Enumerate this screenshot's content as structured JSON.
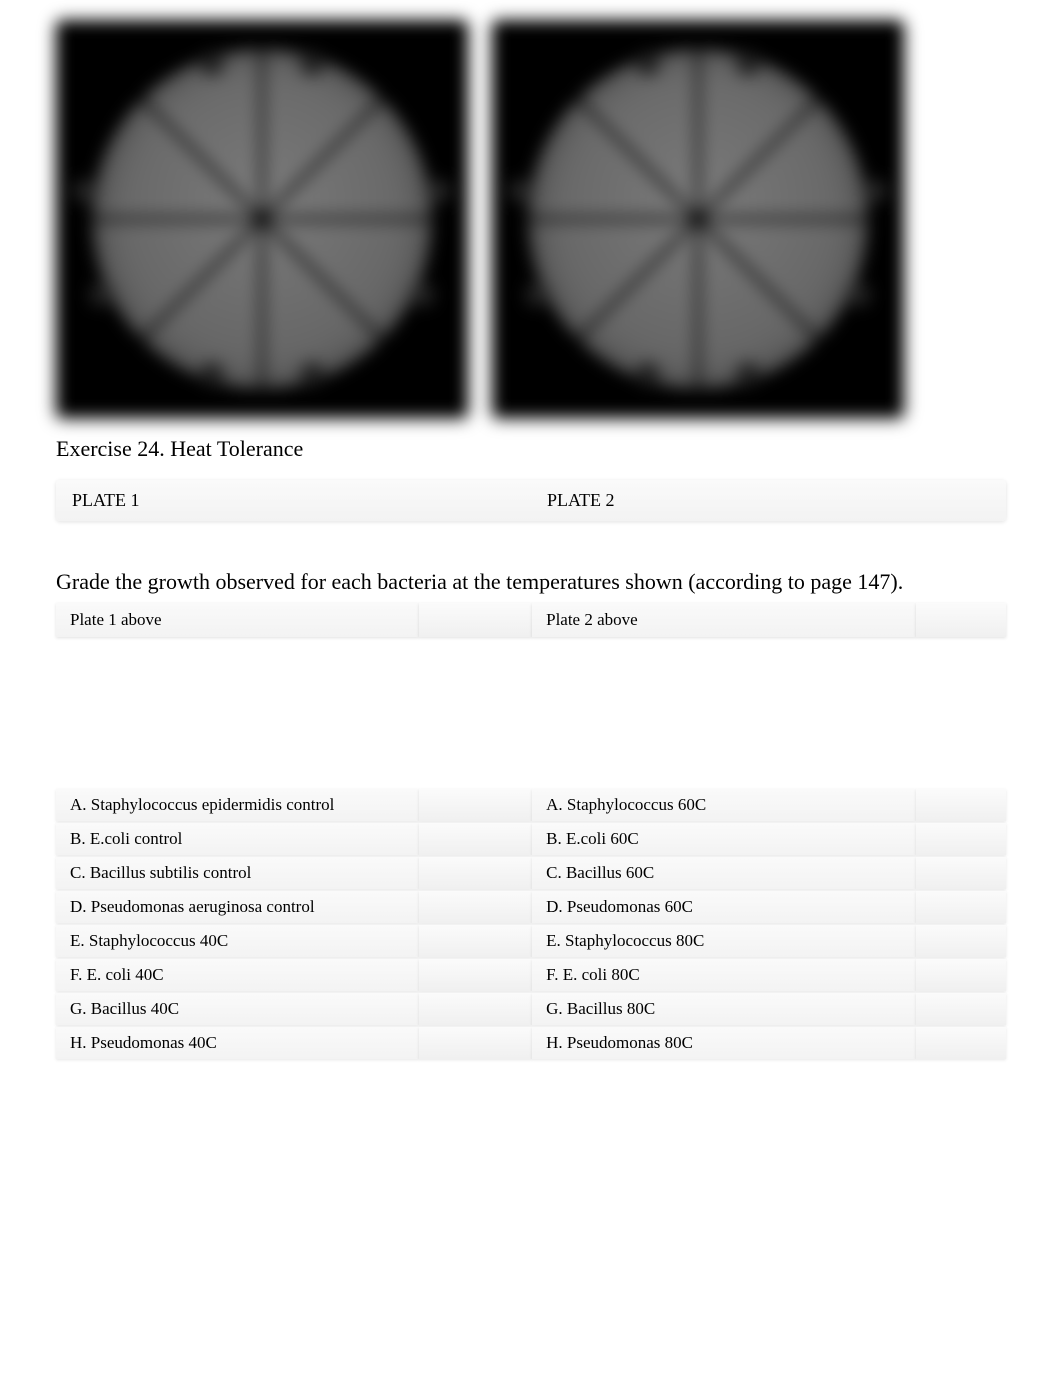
{
  "exercise_title": "Exercise 24. Heat Tolerance",
  "plate_headers": [
    "PLATE 1",
    "PLATE 2"
  ],
  "grade_instruction": "Grade the growth observed for each bacteria at the temperatures shown (according to page 147).",
  "table_headers": {
    "left": "Plate 1 above",
    "right": "Plate 2 above"
  },
  "rows": [
    {
      "left_label": "A. Staphylococcus epidermidis control",
      "left_value": "",
      "right_label": "A. Staphylococcus 60C",
      "right_value": ""
    },
    {
      "left_label": "B. E.coli control",
      "left_value": "",
      "right_label": "B. E.coli 60C",
      "right_value": ""
    },
    {
      "left_label": "C. Bacillus subtilis control",
      "left_value": "",
      "right_label": "C. Bacillus 60C",
      "right_value": ""
    },
    {
      "left_label": "D. Pseudomonas aeruginosa control",
      "left_value": "",
      "right_label": "D. Pseudomonas 60C",
      "right_value": ""
    },
    {
      "left_label": "E. Staphylococcus 40C",
      "left_value": "",
      "right_label": "E. Staphylococcus 80C",
      "right_value": ""
    },
    {
      "left_label": "F. E. coli 40C",
      "left_value": "",
      "right_label": "F. E. coli 80C",
      "right_value": ""
    },
    {
      "left_label": "G. Bacillus 40C",
      "left_value": "",
      "right_label": "G. Bacillus 80C",
      "right_value": ""
    },
    {
      "left_label": "H. Pseudomonas 40C",
      "left_value": "",
      "right_label": "H. Pseudomonas 80C",
      "right_value": ""
    }
  ]
}
